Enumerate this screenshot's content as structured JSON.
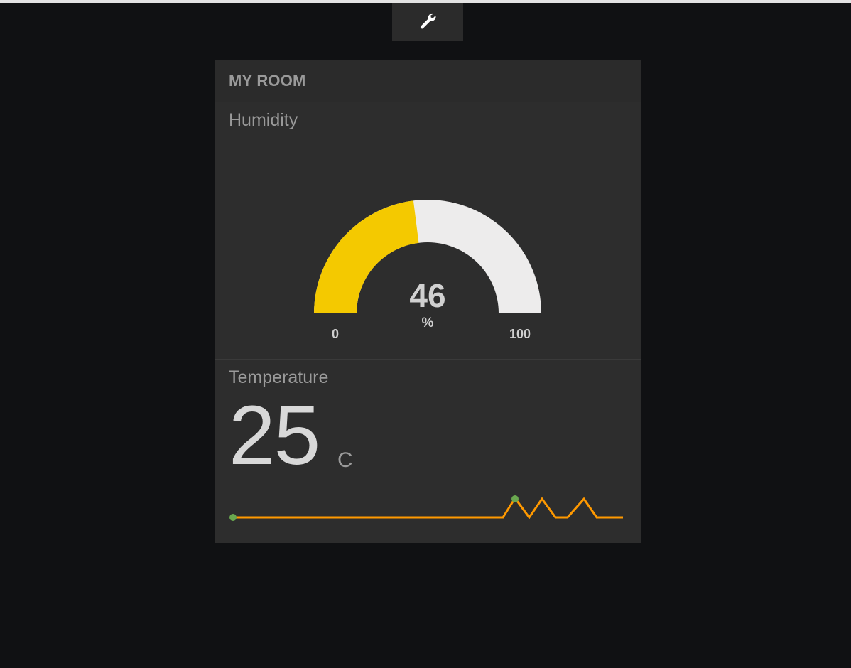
{
  "toolbar": {
    "settings_icon": "wrench-icon"
  },
  "pane": {
    "title": "MY ROOM"
  },
  "humidity": {
    "title": "Humidity",
    "value": "46",
    "units": "%",
    "min_label": "0",
    "max_label": "100",
    "value_fraction": 0.46,
    "fill_color": "#f4c900",
    "track_color": "#edecec"
  },
  "temperature": {
    "title": "Temperature",
    "value": "25",
    "units": "C",
    "sparkline_color": "#ff9900",
    "marker_color": "#6aa84f"
  }
}
